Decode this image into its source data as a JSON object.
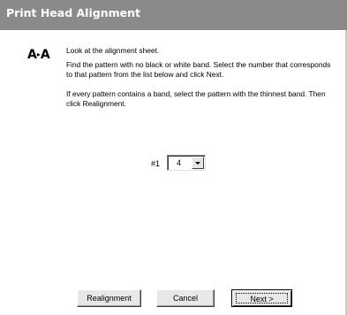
{
  "window": {
    "title": "Print Head Alignment"
  },
  "icon": {
    "name": "align-letters-icon",
    "glyph_left": "A",
    "glyph_mid": "▸",
    "glyph_right": "A"
  },
  "message": {
    "line1": "Look at the alignment sheet.",
    "line2": "Find the pattern with no black or white band. Select the number that corresponds to that pattern from the list below and click Next.",
    "line3": "If every pattern contains a band, select the pattern with the thinnest band. Then click Realignment."
  },
  "pattern_select": {
    "label": "#1",
    "selected_value": "4"
  },
  "buttons": {
    "realignment": "Realignment",
    "cancel": "Cancel",
    "next": "Next >"
  }
}
